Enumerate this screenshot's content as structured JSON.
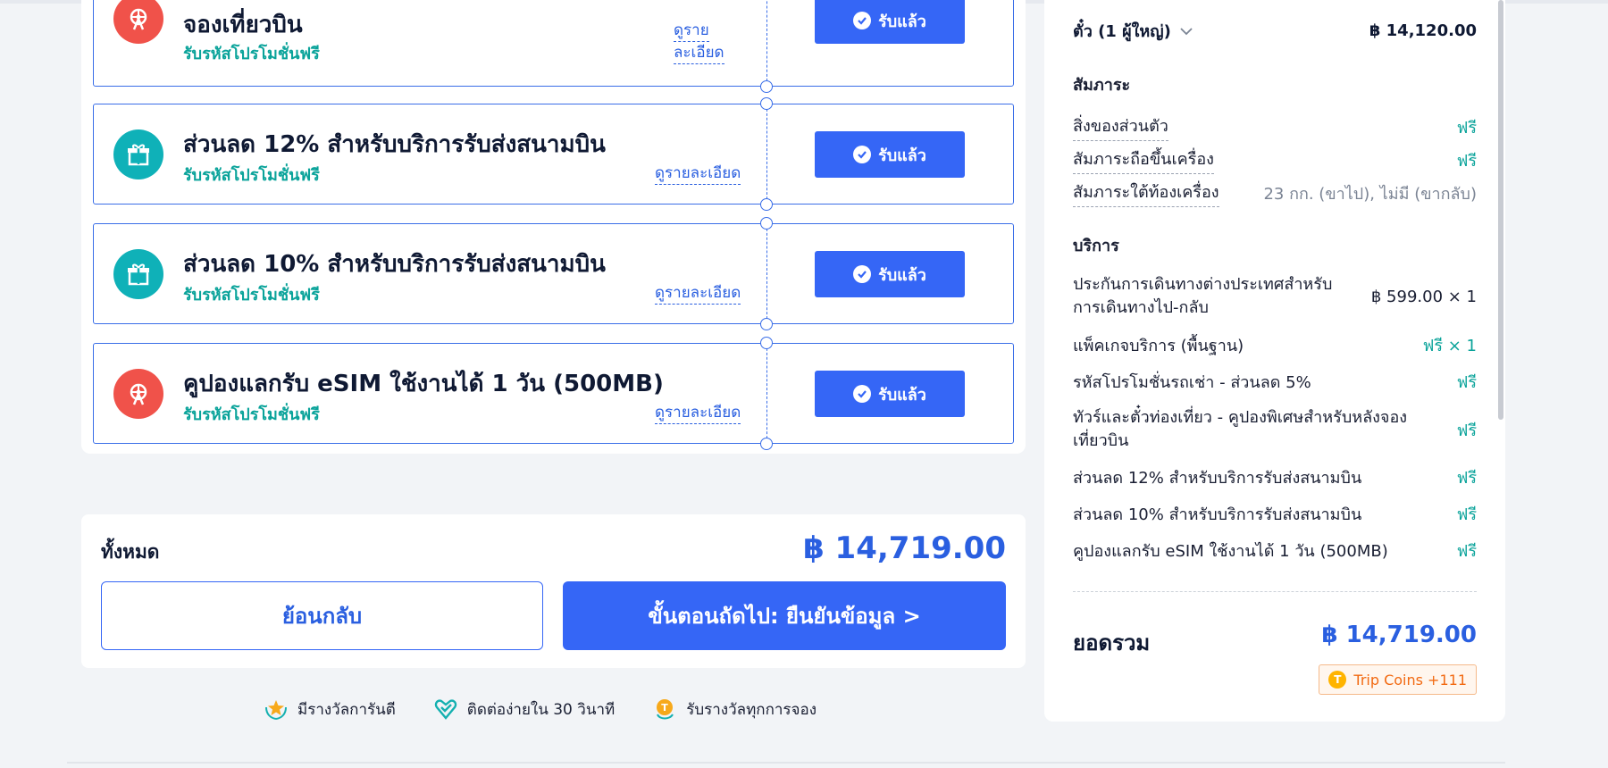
{
  "coupons": [
    {
      "title": "จองเที่ยวบิน",
      "subtitle": "รับรหัสโปรโมชั่นฟรี",
      "details": "ดูรายละเอียด",
      "details_line1": "ดูราย",
      "details_line2": "ละเอียด",
      "button": "รับแล้ว",
      "icon": "ferris-wheel-icon",
      "icon_color": "#f0524a"
    },
    {
      "title": "ส่วนลด 12% สำหรับบริการรับส่งสนามบิน",
      "subtitle": "รับรหัสโปรโมชั่นฟรี",
      "details": "ดูรายละเอียด",
      "button": "รับแล้ว",
      "icon": "gift-icon",
      "icon_color": "#0fb1b8"
    },
    {
      "title": "ส่วนลด 10% สำหรับบริการรับส่งสนามบิน",
      "subtitle": "รับรหัสโปรโมชั่นฟรี",
      "details": "ดูรายละเอียด",
      "button": "รับแล้ว",
      "icon": "gift-icon",
      "icon_color": "#0fb1b8"
    },
    {
      "title": "คูปองแลกรับ eSIM ใช้งานได้ 1 วัน (500MB)",
      "subtitle": "รับรหัสโปรโมชั่นฟรี",
      "details": "ดูรายละเอียด",
      "button": "รับแล้ว",
      "icon": "ferris-wheel-icon",
      "icon_color": "#f0524a"
    }
  ],
  "total": {
    "label": "ทั้งหมด",
    "amount": "฿ 14,719.00",
    "back_label": "ย้อนกลับ",
    "next_label": "ขั้นตอนถัดไป: ยืนยันข้อมูล >"
  },
  "badges": [
    {
      "label": "มีรางวัลการันตี",
      "icon": "laurel-star-icon"
    },
    {
      "label": "ติดต่อง่ายใน 30 วินาที",
      "icon": "heart-check-icon"
    },
    {
      "label": "รับรางวัลทุกการจอง",
      "icon": "coin-icon"
    }
  ],
  "summary": {
    "ticket_label": "ตั๋ว (1 ผู้ใหญ่)",
    "ticket_value": "฿ 14,120.00",
    "baggage_heading": "สัมภาระ",
    "baggage": [
      {
        "label": "สิ่งของส่วนตัว",
        "value": "ฟรี"
      },
      {
        "label": "สัมภาระถือขึ้นเครื่อง",
        "value": "ฟรี"
      },
      {
        "label": "สัมภาระใต้ท้องเครื่อง",
        "value": "23 กก. (ขาไป), ไม่มี (ขากลับ)"
      }
    ],
    "services_heading": "บริการ",
    "services": [
      {
        "label": "ประกันการเดินทางต่างประเทศสำหรับการเดินทางไป-กลับ",
        "label_line1": "ประกันการเดินทางต่างประเทศสำหรับ",
        "label_line2": "การเดินทางไป-กลับ",
        "value": "฿ 599.00 × 1"
      },
      {
        "label": "แพ็คเกจบริการ (พื้นฐาน)",
        "value": "ฟรี × 1"
      },
      {
        "label": "รหัสโปรโมชั่นรถเช่า - ส่วนลด 5%",
        "value": "ฟรี"
      },
      {
        "label": "ทัวร์และตั๋วท่องเที่ยว - คูปองพิเศษสำหรับหลังจองเที่ยวบิน",
        "label_line1": "ทัวร์และตั๋วท่องเที่ยว - คูปองพิเศษสำหรับหลังจอง",
        "label_line2": "เที่ยวบิน",
        "value": "ฟรี"
      },
      {
        "label": "ส่วนลด 12% สำหรับบริการรับส่งสนามบิน",
        "value": "ฟรี"
      },
      {
        "label": "ส่วนลด 10% สำหรับบริการรับส่งสนามบิน",
        "value": "ฟรี"
      },
      {
        "label": "คูปองแลกรับ eSIM ใช้งานได้ 1 วัน (500MB)",
        "value": "ฟรี"
      }
    ],
    "grand_total_label": "ยอดรวม",
    "grand_total_value": "฿ 14,719.00",
    "coins_label": "Trip Coins +111"
  }
}
